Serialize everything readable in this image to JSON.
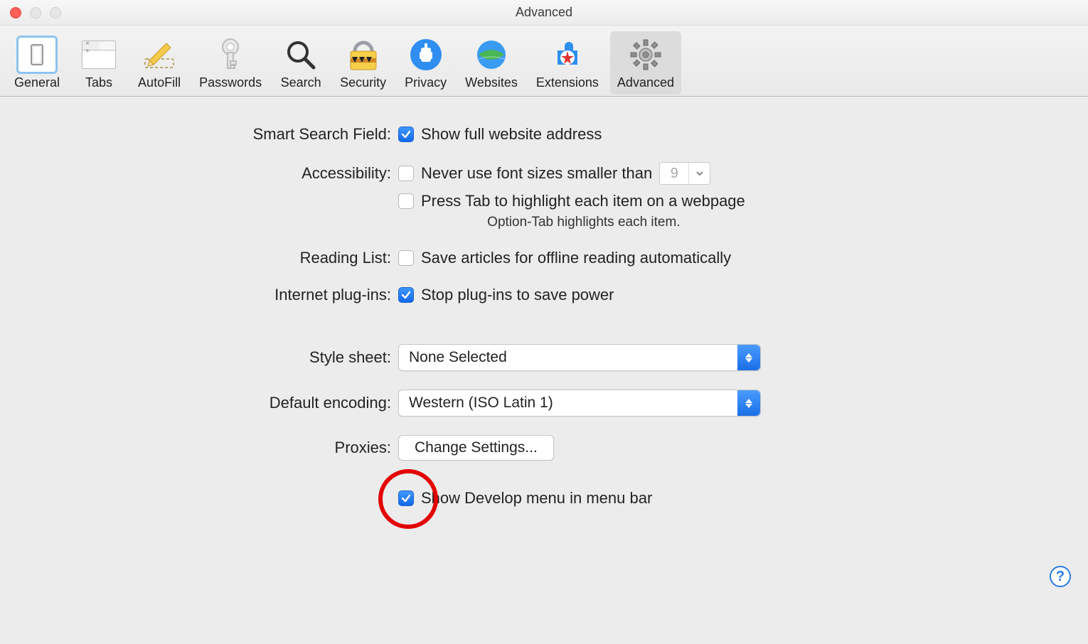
{
  "window": {
    "title": "Advanced"
  },
  "tabs": [
    {
      "label": "General"
    },
    {
      "label": "Tabs"
    },
    {
      "label": "AutoFill"
    },
    {
      "label": "Passwords"
    },
    {
      "label": "Search"
    },
    {
      "label": "Security"
    },
    {
      "label": "Privacy"
    },
    {
      "label": "Websites"
    },
    {
      "label": "Extensions"
    },
    {
      "label": "Advanced"
    }
  ],
  "smartSearch": {
    "label": "Smart Search Field:",
    "showFullAddress": {
      "checked": true,
      "text": "Show full website address"
    }
  },
  "accessibility": {
    "label": "Accessibility:",
    "neverFont": {
      "checked": false,
      "text": "Never use font sizes smaller than",
      "value": "9"
    },
    "pressTab": {
      "checked": false,
      "text": "Press Tab to highlight each item on a webpage"
    },
    "help": "Option-Tab highlights each item."
  },
  "readingList": {
    "label": "Reading List:",
    "saveOffline": {
      "checked": false,
      "text": "Save articles for offline reading automatically"
    }
  },
  "plugins": {
    "label": "Internet plug-ins:",
    "stop": {
      "checked": true,
      "text": "Stop plug-ins to save power"
    }
  },
  "stylesheet": {
    "label": "Style sheet:",
    "value": "None Selected"
  },
  "encoding": {
    "label": "Default encoding:",
    "value": "Western (ISO Latin 1)"
  },
  "proxies": {
    "label": "Proxies:",
    "button": "Change Settings..."
  },
  "develop": {
    "checked": true,
    "text": "Show Develop menu in menu bar"
  },
  "helpBadge": "?"
}
